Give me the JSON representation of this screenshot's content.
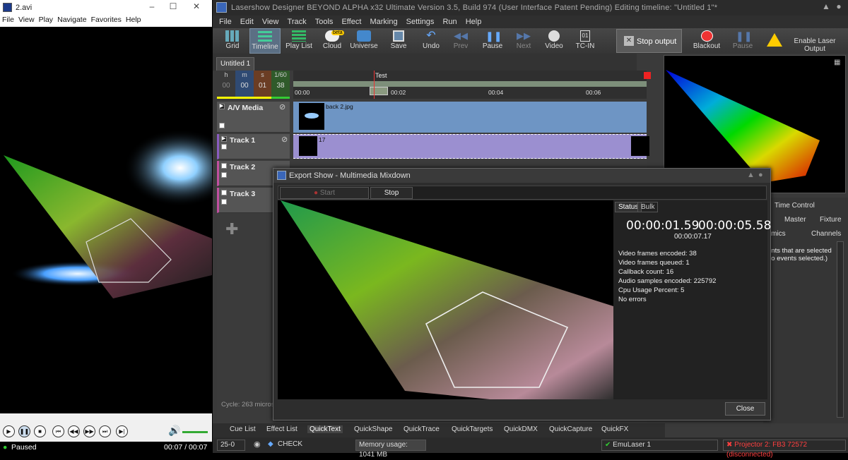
{
  "media_player": {
    "title": "2.avi",
    "menu": [
      "File",
      "View",
      "Play",
      "Navigate",
      "Favorites",
      "Help"
    ],
    "status": "Paused",
    "time": "00:07 / 00:07"
  },
  "app": {
    "title": "Lasershow Designer BEYOND ALPHA x32 Ultimate   Version 3.5, Build 974   (User Interface Patent Pending)   Editing timeline: \"Untitled 1\"*",
    "menu": [
      "File",
      "Edit",
      "View",
      "Track",
      "Tools",
      "Effect",
      "Marking",
      "Settings",
      "Run",
      "Help"
    ],
    "toolbar": {
      "grid": "Grid",
      "timeline": "Timeline",
      "playlist": "Play List",
      "cloud": "Cloud",
      "beta": "beta",
      "universe": "Universe",
      "save": "Save",
      "undo": "Undo",
      "prev": "Prev",
      "pause": "Pause",
      "next": "Next",
      "video": "Video",
      "tcin": "TC-IN",
      "stop_output": "Stop output",
      "blackout": "Blackout",
      "pause2": "Pause",
      "enable_laser": "Enable Laser Output"
    },
    "tab": "Untitled 1",
    "hms": {
      "labels": [
        "h",
        "m",
        "s",
        "1/60"
      ],
      "values": [
        "00",
        "00",
        "01",
        "38"
      ]
    },
    "ruler": {
      "marker": "Test",
      "ticks": [
        "00:00",
        "00:02",
        "00:04",
        "00:06"
      ]
    },
    "tracks": [
      "A/V Media",
      "Track 1",
      "Track 2",
      "Track 3"
    ],
    "clip_av_label": "back 2.jpg",
    "clip_t1_label": "17",
    "cycle": "Cycle: 263 microsec",
    "right_panel": {
      "time_control": "Time Control",
      "master": "Master",
      "fixture": "Fixture",
      "dynamics": "namics",
      "channels": "Channels",
      "selection": "ents that are selected\nno events selected.)"
    },
    "bottom_tabs": [
      "Cue List",
      "Effect List",
      "QuickText",
      "QuickShape",
      "QuickTrace",
      "QuickTargets",
      "QuickDMX",
      "QuickCapture",
      "QuickFX"
    ],
    "status": {
      "fps": "25-0",
      "check": "CHECK",
      "memory": "Memory usage: 1041 MB",
      "emu": "EmuLaser 1",
      "projector": "Projector 2: FB3 72572 (disconnected)"
    }
  },
  "export_dialog": {
    "title": "Export Show - Multimedia Mixdown",
    "start": "Start",
    "stop": "Stop",
    "tabs": [
      "Status",
      "Bulk"
    ],
    "time_current": "00:00:01.59",
    "time_total": "00:00:05.58",
    "time_sub": "00:00:07.17",
    "stats": [
      "Video frames encoded: 38",
      "Video frames queued: 1",
      "Callback count: 16",
      "Audio samples encoded: 225792",
      "Cpu Usage Percent: 5",
      "No errors"
    ],
    "close": "Close"
  },
  "colors": {
    "accent": "#5b6f84",
    "track_av": "#6e95c4",
    "track1": "#9b8fd0",
    "error": "#ff4040"
  }
}
